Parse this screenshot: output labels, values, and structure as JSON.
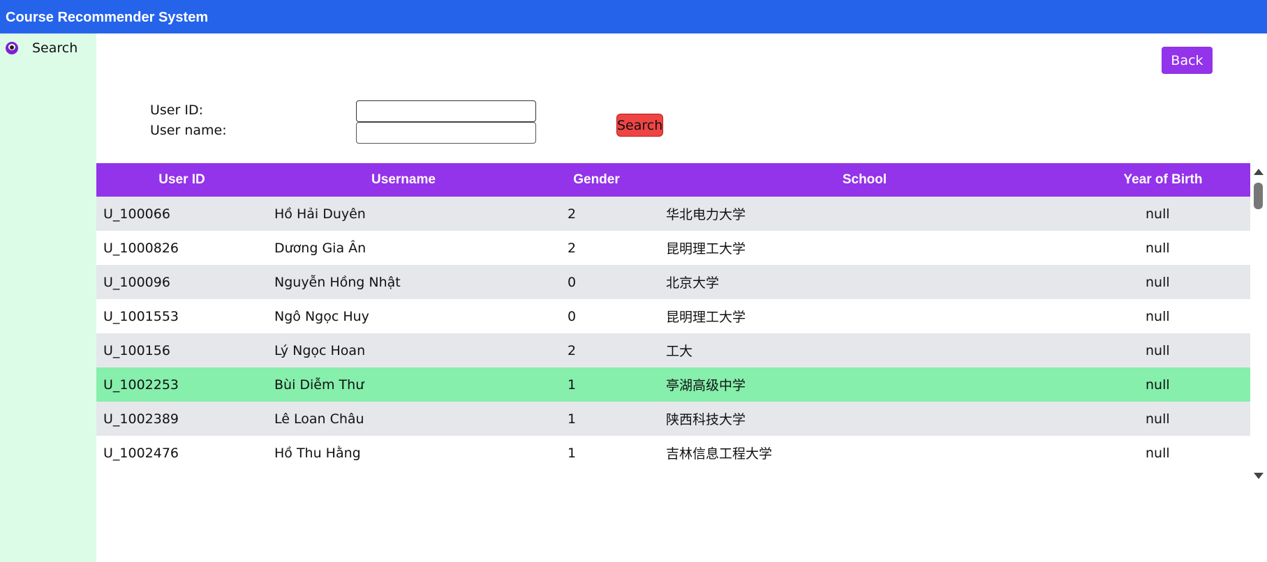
{
  "app": {
    "title": "Course Recommender System"
  },
  "sidebar": {
    "items": [
      {
        "label": "Search",
        "icon": "eye-icon"
      }
    ]
  },
  "actions": {
    "back_label": "Back",
    "search_label": "Search"
  },
  "form": {
    "user_id_label": "User ID:",
    "user_name_label": "User name:",
    "user_id_value": "",
    "user_name_value": ""
  },
  "table": {
    "columns": [
      "User ID",
      "Username",
      "Gender",
      "School",
      "Year of Birth"
    ],
    "rows": [
      [
        "U_100066",
        "Hồ Hải Duyên",
        "2",
        "华北电力大学",
        "null"
      ],
      [
        "U_1000826",
        "Dương Gia Ân",
        "2",
        "昆明理工大学",
        "null"
      ],
      [
        "U_100096",
        "Nguyễn Hồng Nhật",
        "0",
        "北京大学",
        "null"
      ],
      [
        "U_1001553",
        "Ngô Ngọc Huy",
        "0",
        "昆明理工大学",
        "null"
      ],
      [
        "U_100156",
        "Lý Ngọc Hoan",
        "2",
        "工大",
        "null"
      ],
      [
        "U_1002253",
        "Bùi Diễm Thư",
        "1",
        "亭湖高级中学",
        "null"
      ],
      [
        "U_1002389",
        "Lê Loan Châu",
        "1",
        "陕西科技大学",
        "null"
      ],
      [
        "U_1002476",
        "Hồ Thu Hằng",
        "1",
        "吉林信息工程大学",
        "null"
      ]
    ],
    "selected_row_index": 5
  },
  "colors": {
    "topbar": "#2563eb",
    "sidebar": "#dcfce7",
    "accent": "#9333ea",
    "search_button": "#ef4444",
    "selected_row": "#86efac"
  }
}
